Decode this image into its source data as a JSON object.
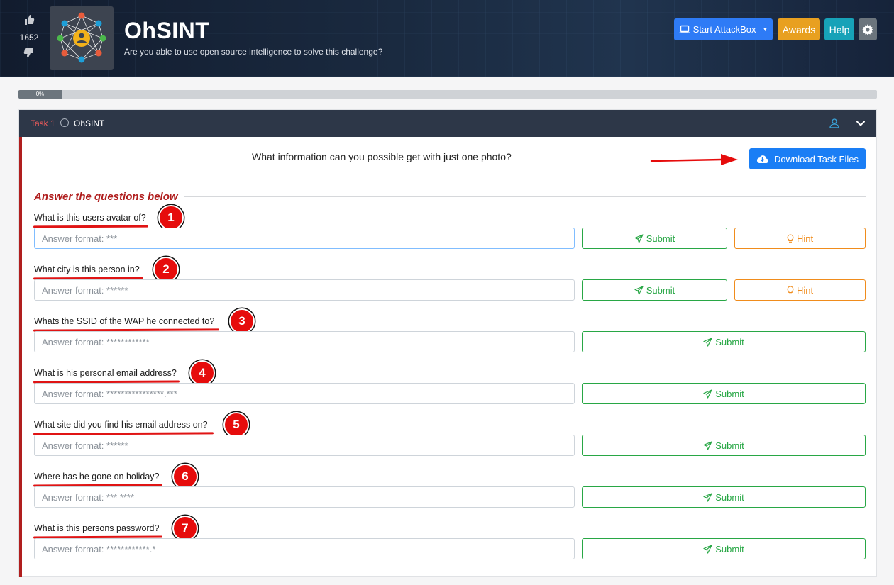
{
  "header": {
    "upvote_count": "1652",
    "title": "OhSINT",
    "subtitle": "Are you able to use open source intelligence to solve this challenge?",
    "buttons": {
      "attackbox": "Start AttackBox",
      "awards": "Awards",
      "help": "Help"
    }
  },
  "progress": {
    "label": "0%",
    "value": 0
  },
  "task": {
    "number_label": "Task 1",
    "name": "OhSINT",
    "intro": "What information can you possible get with just one photo?",
    "download_label": "Download Task Files",
    "answers_heading": "Answer the questions below",
    "submit_label": "Submit",
    "hint_label": "Hint",
    "questions": [
      {
        "number": "1",
        "text": "What is this users avatar of?",
        "placeholder": "Answer format: ***",
        "has_hint": true
      },
      {
        "number": "2",
        "text": "What city is this person in?",
        "placeholder": "Answer format: ******",
        "has_hint": true
      },
      {
        "number": "3",
        "text": "Whats the SSID of the WAP he connected to?",
        "placeholder": "Answer format: ************",
        "has_hint": false
      },
      {
        "number": "4",
        "text": "What is his personal email address?",
        "placeholder": "Answer format: ****************.***",
        "has_hint": false
      },
      {
        "number": "5",
        "text": "What site did you find his email address on?",
        "placeholder": "Answer format: ******",
        "has_hint": false
      },
      {
        "number": "6",
        "text": "Where has he gone on holiday?",
        "placeholder": "Answer format: *** ****",
        "has_hint": false
      },
      {
        "number": "7",
        "text": "What is this persons password?",
        "placeholder": "Answer format: ************.*",
        "has_hint": false
      }
    ]
  },
  "colors": {
    "accent_red": "#b01e1e",
    "annotation_red": "#e60c0c",
    "submit_green": "#28a745",
    "hint_orange": "#f08c1c",
    "primary_blue": "#1a7ef5"
  },
  "icons": [
    "thumbs-up-icon",
    "thumbs-down-icon",
    "room-logo-icon",
    "laptop-icon",
    "caret-down-icon",
    "gear-icon",
    "cloud-download-icon",
    "paper-plane-icon",
    "lightbulb-icon",
    "chevron-down-icon",
    "user-group-icon"
  ]
}
